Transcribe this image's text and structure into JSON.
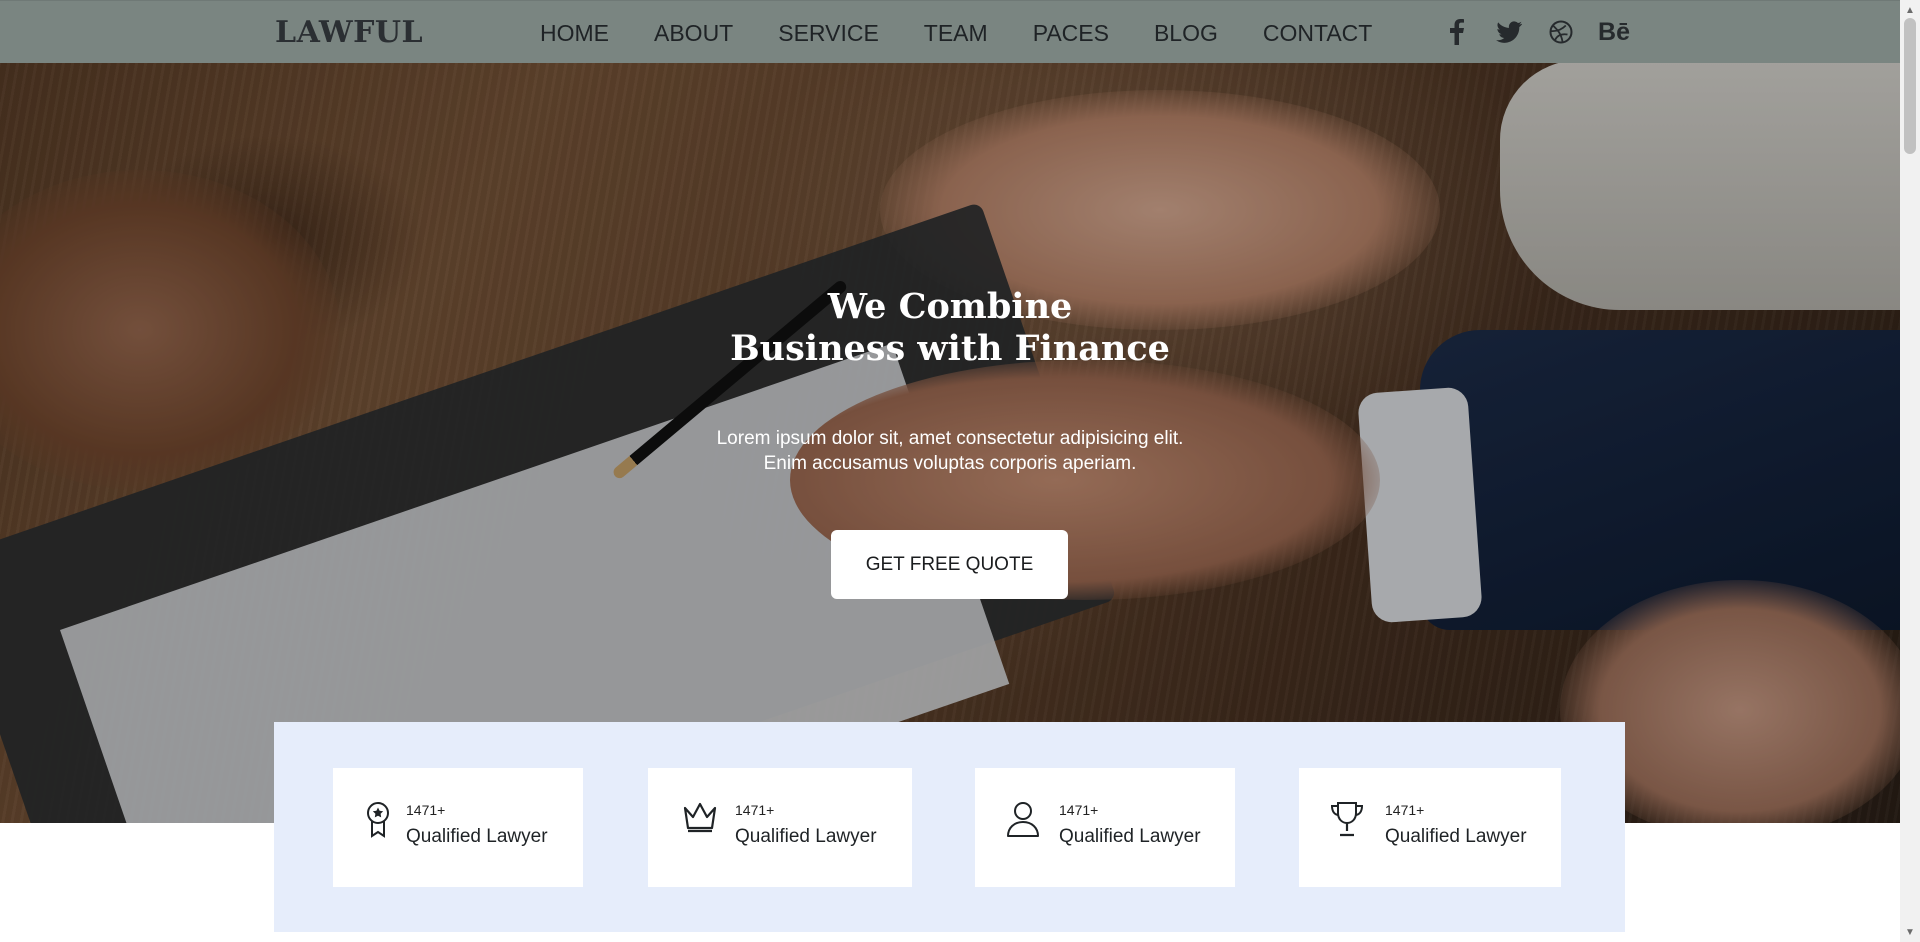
{
  "brand": {
    "logo_text": "LAWFUL"
  },
  "nav": {
    "items": [
      {
        "label": "HOME"
      },
      {
        "label": "ABOUT"
      },
      {
        "label": "SERVICE"
      },
      {
        "label": "TEAM"
      },
      {
        "label": "PACES"
      },
      {
        "label": "BLOG"
      },
      {
        "label": "CONTACT"
      }
    ]
  },
  "socials": [
    {
      "icon": "facebook-icon"
    },
    {
      "icon": "twitter-icon"
    },
    {
      "icon": "dribbble-icon"
    },
    {
      "icon": "behance-icon",
      "text": "Bē"
    }
  ],
  "hero": {
    "title_line1": "We Combine",
    "title_line2": "Business with Finance",
    "subtitle_line1": "Lorem ipsum dolor sit, amet consectetur adipisicing elit.",
    "subtitle_line2": "Enim accusamus voluptas corporis aperiam.",
    "cta_label": "GET FREE QUOTE"
  },
  "stats": [
    {
      "icon": "award-medal-icon",
      "count": "1471+",
      "label": "Qualified Lawyer"
    },
    {
      "icon": "crown-icon",
      "count": "1471+",
      "label": "Qualified Lawyer"
    },
    {
      "icon": "user-icon",
      "count": "1471+",
      "label": "Qualified Lawyer"
    },
    {
      "icon": "trophy-icon",
      "count": "1471+",
      "label": "Qualified Lawyer"
    }
  ],
  "colors": {
    "navbar_bg": "#7a8581",
    "stats_panel_bg": "#e6edfb",
    "button_bg": "#ffffff",
    "text_dark": "#1f2326"
  }
}
